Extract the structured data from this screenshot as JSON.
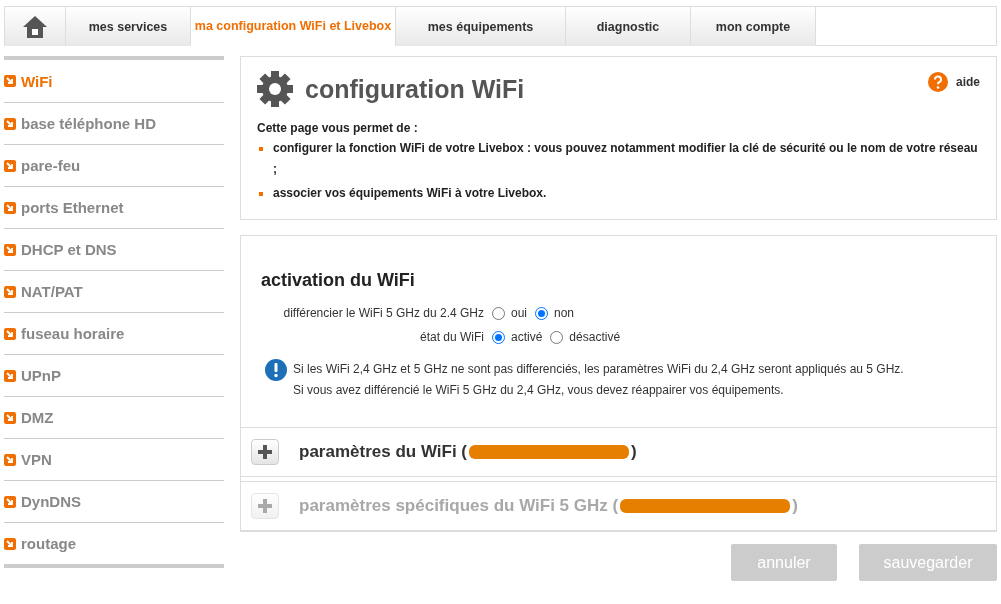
{
  "tabs": [
    {
      "kind": "home",
      "selected": false
    },
    {
      "kind": "text",
      "label": "mes services",
      "selected": false
    },
    {
      "kind": "text",
      "label": "ma configuration WiFi et Livebox",
      "selected": true
    },
    {
      "kind": "text",
      "label": "mes équipements",
      "selected": false
    },
    {
      "kind": "text",
      "label": "diagnostic",
      "selected": false
    },
    {
      "kind": "text",
      "label": "mon compte",
      "selected": false
    }
  ],
  "sidebar": {
    "items": [
      {
        "label": "WiFi",
        "selected": true
      },
      {
        "label": "base téléphone HD",
        "selected": false
      },
      {
        "label": "pare-feu",
        "selected": false
      },
      {
        "label": "ports Ethernet",
        "selected": false
      },
      {
        "label": "DHCP et DNS",
        "selected": false
      },
      {
        "label": "NAT/PAT",
        "selected": false
      },
      {
        "label": "fuseau horaire",
        "selected": false
      },
      {
        "label": "UPnP",
        "selected": false
      },
      {
        "label": "DMZ",
        "selected": false
      },
      {
        "label": "VPN",
        "selected": false
      },
      {
        "label": "DynDNS",
        "selected": false
      },
      {
        "label": "routage",
        "selected": false
      }
    ]
  },
  "intro": {
    "title": "configuration WiFi",
    "help": "aide",
    "lead": "Cette page vous permet de :",
    "bullets": [
      "configurer la fonction WiFi de votre Livebox : vous pouvez notamment modifier la clé de sécurité ou le nom de votre réseau ;",
      "associer vos équipements WiFi à votre Livebox."
    ]
  },
  "activation": {
    "title": "activation du WiFi",
    "rows": [
      {
        "label": "différencier le WiFi 5 GHz du 2.4 GHz",
        "options": [
          {
            "label": "oui",
            "selected": false
          },
          {
            "label": "non",
            "selected": true
          }
        ]
      },
      {
        "label": "état du WiFi",
        "options": [
          {
            "label": "activé",
            "selected": true
          },
          {
            "label": "désactivé",
            "selected": false
          }
        ]
      }
    ],
    "info": [
      "Si les WiFi 2,4 GHz et 5 GHz ne sont pas differenciés, les paramètres WiFi du 2,4 GHz seront appliqués au 5 GHz.",
      "Si vous avez différencié le WiFi 5 GHz du 2,4 GHz, vous devez réappairer vos équipements."
    ]
  },
  "sections": [
    {
      "title": "paramètres du WiFi (",
      "title_end": ")",
      "disabled": false,
      "expanded": false
    },
    {
      "title": "paramètres spécifiques du WiFi 5 GHz (",
      "title_end": ")",
      "disabled": true,
      "expanded": false
    }
  ],
  "buttons": [
    {
      "label": "annuler",
      "disabled": true
    },
    {
      "label": "sauvegarder",
      "disabled": true
    }
  ]
}
